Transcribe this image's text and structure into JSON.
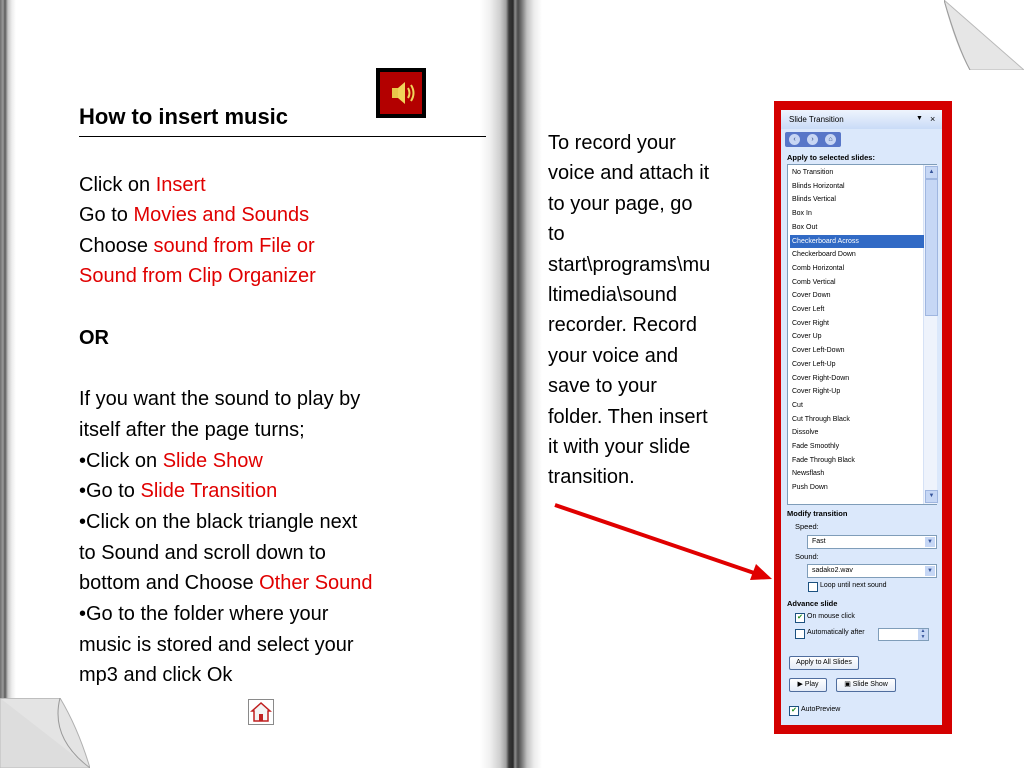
{
  "left_page": {
    "heading": "How to insert music",
    "line1_prefix": "Click on ",
    "line1_red": "Insert",
    "line2_prefix": "Go to ",
    "line2_red": "Movies and Sounds",
    "line3_prefix": "Choose ",
    "line3_red": "sound from File or",
    "line4_red": "Sound from Clip Organizer",
    "or": "OR",
    "p1": "If you want the sound to play by",
    "p2": "itself after the page turns;",
    "b1_prefix": "•Click on ",
    "b1_red": "Slide Show",
    "b2_prefix": "•Go to ",
    "b2_red": "Slide Transition",
    "b3a": "•Click on the black triangle next",
    "b3b": "to Sound and scroll down to",
    "b3c_prefix": "bottom and Choose ",
    "b3c_red": "Other Sound",
    "b4a": "•Go to the folder where your",
    "b4b": "music is stored and select your",
    "b4c": "mp3 and click Ok"
  },
  "right_page": {
    "lines": [
      "To record your",
      "voice and attach it",
      "to your page, go",
      "to",
      "start\\programs\\mu",
      "ltimedia\\sound",
      "recorder. Record",
      "your voice and",
      "save to your",
      "folder. Then insert",
      "it with your slide",
      "transition."
    ]
  },
  "task_pane": {
    "title": "Slide Transition",
    "dropdown_glyph": "▼",
    "close_glyph": "×",
    "apply_label": "Apply to selected slides:",
    "transitions": [
      "No Transition",
      "Blinds Horizontal",
      "Blinds Vertical",
      "Box In",
      "Box Out",
      "Checkerboard Across",
      "Checkerboard Down",
      "Comb Horizontal",
      "Comb Vertical",
      "Cover Down",
      "Cover Left",
      "Cover Right",
      "Cover Up",
      "Cover Left-Down",
      "Cover Left-Up",
      "Cover Right-Down",
      "Cover Right-Up",
      "Cut",
      "Cut Through Black",
      "Dissolve",
      "Fade Smoothly",
      "Fade Through Black",
      "Newsflash",
      "Push Down"
    ],
    "selected_transition": "Checkerboard Across",
    "modify_label": "Modify transition",
    "speed_label": "Speed:",
    "speed_value": "Fast",
    "sound_label": "Sound:",
    "sound_value": "sadako2.wav",
    "loop_label": "Loop until next sound",
    "advance_label": "Advance slide",
    "on_click_label": "On mouse click",
    "auto_after_label": "Automatically after",
    "apply_all_label": "Apply to All Slides",
    "play_label": "Play",
    "slideshow_label": "Slide Show",
    "autopreview_label": "AutoPreview",
    "loop_checked": false,
    "on_click_checked": true,
    "auto_after_checked": false,
    "autopreview_checked": true
  },
  "colors": {
    "highlight_text": "#e00000",
    "pane_frame": "#d40000",
    "pane_background": "#dbe8fb",
    "selection": "#316ac5"
  },
  "icons": {
    "sound": "speaker-icon",
    "home": "home-icon",
    "arrow": "red-arrow-icon"
  }
}
